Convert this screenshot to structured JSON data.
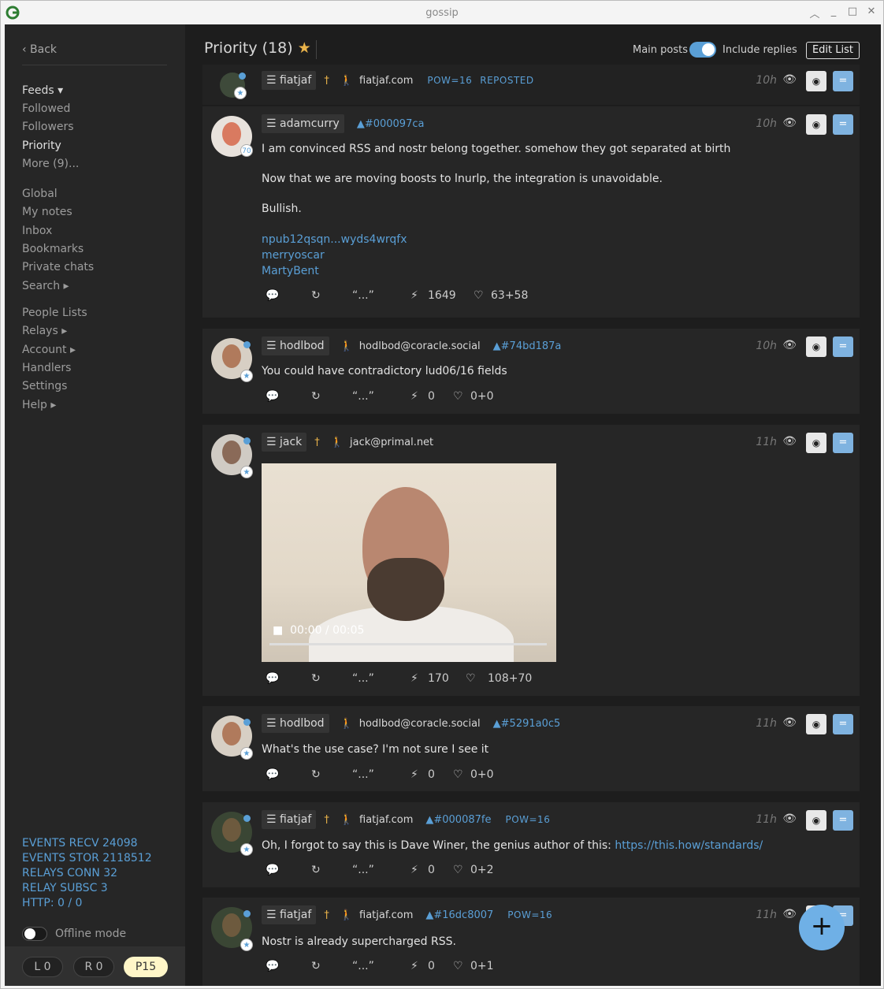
{
  "window": {
    "title": "gossip"
  },
  "sidebar": {
    "back": "‹ Back",
    "feeds": "Feeds ▾",
    "items": [
      "Followed",
      "Followers",
      "Priority",
      "More (9)..."
    ],
    "items2": [
      "Global",
      "My notes",
      "Inbox",
      "Bookmarks",
      "Private chats",
      "Search ▸"
    ],
    "items3": [
      "People Lists",
      "Relays ▸",
      "Account ▸",
      "Handlers",
      "Settings",
      "Help ▸"
    ],
    "stats": [
      "EVENTS RECV 24098",
      "EVENTS STOR 2118512",
      "RELAYS CONN 32",
      "RELAY SUBSC 3",
      "HTTP: 0 / 0"
    ],
    "offline": "Offline mode",
    "pills": [
      "L 0",
      "R 0",
      "P15"
    ]
  },
  "header": {
    "title": "Priority (18)",
    "star": "★",
    "main_posts": "Main posts",
    "include_replies": "Include replies",
    "edit_list": "Edit List"
  },
  "posts": [
    {
      "name": "fiatjaf",
      "nip05": "fiatjaf.com",
      "hash": "",
      "pow": "POW=16",
      "reposted": "REPOSTED",
      "time": "10h"
    },
    {
      "name": "adamcurry",
      "hash": "▲#000097ca",
      "time": "10h",
      "badge": "70",
      "lines": [
        "I am convinced RSS and nostr belong together. somehow they got separated at birth",
        "Now that we are moving boosts to lnurlp, the integration is unavoidable.",
        "Bullish."
      ],
      "mentions": [
        "npub12qsqn...wyds4wrqfx",
        "merryoscar",
        "MartyBent"
      ],
      "zaps": "1649",
      "likes": "63+58"
    },
    {
      "name": "hodlbod",
      "nip05": "hodlbod@coracle.social",
      "hash": "▲#74bd187a",
      "time": "10h",
      "text": "You could have contradictory lud06/16 fields",
      "zaps": "0",
      "likes": "0+0"
    },
    {
      "name": "jack",
      "nip05": "jack@primal.net",
      "time": "11h",
      "video_time": "00:00 / 00:05",
      "zaps": "170",
      "likes": "108+70"
    },
    {
      "name": "hodlbod",
      "nip05": "hodlbod@coracle.social",
      "hash": "▲#5291a0c5",
      "time": "11h",
      "text": "What's the use case? I'm not sure I see it",
      "zaps": "0",
      "likes": "0+0"
    },
    {
      "name": "fiatjaf",
      "nip05": "fiatjaf.com",
      "hash": "▲#000087fe",
      "pow": "POW=16",
      "time": "11h",
      "text": "Oh, I forgot to say this is Dave Winer, the genius author of this: ",
      "link": "https://this.how/standards/",
      "zaps": "0",
      "likes": "0+2"
    },
    {
      "name": "fiatjaf",
      "nip05": "fiatjaf.com",
      "hash": "▲#16dc8007",
      "pow": "POW=16",
      "time": "11h",
      "text": "Nostr is already supercharged RSS.",
      "zaps": "0",
      "likes": "0+1"
    }
  ],
  "icons": {
    "menu": "☰",
    "reply": "💬",
    "repost": "↻",
    "quote": "“...”",
    "zap": "⚡",
    "like": "♡",
    "eye": "👁",
    "person": "🚶",
    "dagger": "†",
    "fab": "+"
  },
  "colors": {
    "accent": "#5a9fd6",
    "background": "#1d1d1d",
    "card": "#262626",
    "priority_pill": "#fff6c8"
  }
}
